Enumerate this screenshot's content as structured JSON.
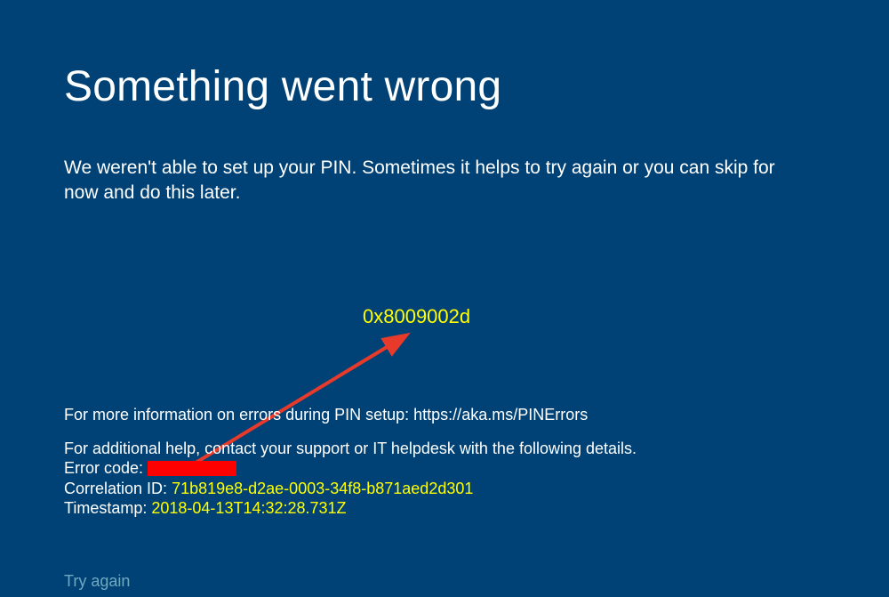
{
  "title": "Something went wrong",
  "message": "We weren't able to set up your PIN. Sometimes it helps to try again or you can skip for now and do this later.",
  "annotation": {
    "error_code": "0x8009002d"
  },
  "info": {
    "more_info": "For more information on errors during PIN setup: https://aka.ms/PINErrors",
    "help_line": "For additional help, contact your support or IT helpdesk with the following details.",
    "error_code_label": "Error code:",
    "correlation_label": "Correlation ID:",
    "correlation_value": "71b819e8-d2ae-0003-34f8-b871aed2d301",
    "timestamp_label": "Timestamp:",
    "timestamp_value": "2018-04-13T14:32:28.731Z"
  },
  "actions": {
    "try_again": "Try again"
  }
}
